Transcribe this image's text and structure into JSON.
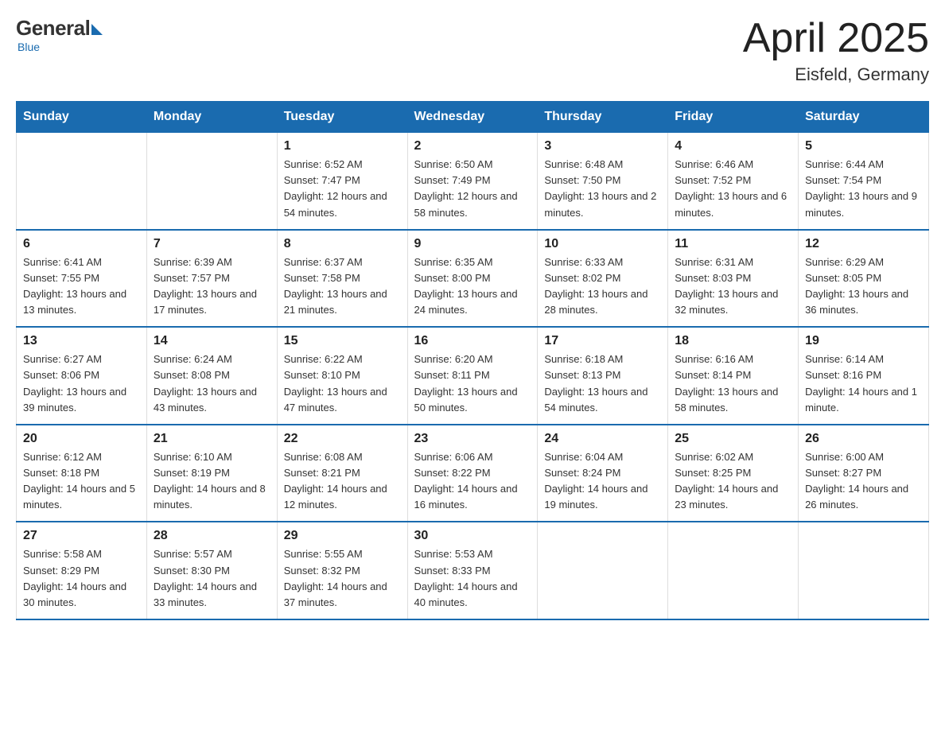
{
  "logo": {
    "general": "General",
    "blue": "Blue",
    "tagline": "Blue"
  },
  "header": {
    "month_year": "April 2025",
    "location": "Eisfeld, Germany"
  },
  "weekdays": [
    "Sunday",
    "Monday",
    "Tuesday",
    "Wednesday",
    "Thursday",
    "Friday",
    "Saturday"
  ],
  "weeks": [
    [
      {
        "day": "",
        "sunrise": "",
        "sunset": "",
        "daylight": ""
      },
      {
        "day": "",
        "sunrise": "",
        "sunset": "",
        "daylight": ""
      },
      {
        "day": "1",
        "sunrise": "Sunrise: 6:52 AM",
        "sunset": "Sunset: 7:47 PM",
        "daylight": "Daylight: 12 hours and 54 minutes."
      },
      {
        "day": "2",
        "sunrise": "Sunrise: 6:50 AM",
        "sunset": "Sunset: 7:49 PM",
        "daylight": "Daylight: 12 hours and 58 minutes."
      },
      {
        "day": "3",
        "sunrise": "Sunrise: 6:48 AM",
        "sunset": "Sunset: 7:50 PM",
        "daylight": "Daylight: 13 hours and 2 minutes."
      },
      {
        "day": "4",
        "sunrise": "Sunrise: 6:46 AM",
        "sunset": "Sunset: 7:52 PM",
        "daylight": "Daylight: 13 hours and 6 minutes."
      },
      {
        "day": "5",
        "sunrise": "Sunrise: 6:44 AM",
        "sunset": "Sunset: 7:54 PM",
        "daylight": "Daylight: 13 hours and 9 minutes."
      }
    ],
    [
      {
        "day": "6",
        "sunrise": "Sunrise: 6:41 AM",
        "sunset": "Sunset: 7:55 PM",
        "daylight": "Daylight: 13 hours and 13 minutes."
      },
      {
        "day": "7",
        "sunrise": "Sunrise: 6:39 AM",
        "sunset": "Sunset: 7:57 PM",
        "daylight": "Daylight: 13 hours and 17 minutes."
      },
      {
        "day": "8",
        "sunrise": "Sunrise: 6:37 AM",
        "sunset": "Sunset: 7:58 PM",
        "daylight": "Daylight: 13 hours and 21 minutes."
      },
      {
        "day": "9",
        "sunrise": "Sunrise: 6:35 AM",
        "sunset": "Sunset: 8:00 PM",
        "daylight": "Daylight: 13 hours and 24 minutes."
      },
      {
        "day": "10",
        "sunrise": "Sunrise: 6:33 AM",
        "sunset": "Sunset: 8:02 PM",
        "daylight": "Daylight: 13 hours and 28 minutes."
      },
      {
        "day": "11",
        "sunrise": "Sunrise: 6:31 AM",
        "sunset": "Sunset: 8:03 PM",
        "daylight": "Daylight: 13 hours and 32 minutes."
      },
      {
        "day": "12",
        "sunrise": "Sunrise: 6:29 AM",
        "sunset": "Sunset: 8:05 PM",
        "daylight": "Daylight: 13 hours and 36 minutes."
      }
    ],
    [
      {
        "day": "13",
        "sunrise": "Sunrise: 6:27 AM",
        "sunset": "Sunset: 8:06 PM",
        "daylight": "Daylight: 13 hours and 39 minutes."
      },
      {
        "day": "14",
        "sunrise": "Sunrise: 6:24 AM",
        "sunset": "Sunset: 8:08 PM",
        "daylight": "Daylight: 13 hours and 43 minutes."
      },
      {
        "day": "15",
        "sunrise": "Sunrise: 6:22 AM",
        "sunset": "Sunset: 8:10 PM",
        "daylight": "Daylight: 13 hours and 47 minutes."
      },
      {
        "day": "16",
        "sunrise": "Sunrise: 6:20 AM",
        "sunset": "Sunset: 8:11 PM",
        "daylight": "Daylight: 13 hours and 50 minutes."
      },
      {
        "day": "17",
        "sunrise": "Sunrise: 6:18 AM",
        "sunset": "Sunset: 8:13 PM",
        "daylight": "Daylight: 13 hours and 54 minutes."
      },
      {
        "day": "18",
        "sunrise": "Sunrise: 6:16 AM",
        "sunset": "Sunset: 8:14 PM",
        "daylight": "Daylight: 13 hours and 58 minutes."
      },
      {
        "day": "19",
        "sunrise": "Sunrise: 6:14 AM",
        "sunset": "Sunset: 8:16 PM",
        "daylight": "Daylight: 14 hours and 1 minute."
      }
    ],
    [
      {
        "day": "20",
        "sunrise": "Sunrise: 6:12 AM",
        "sunset": "Sunset: 8:18 PM",
        "daylight": "Daylight: 14 hours and 5 minutes."
      },
      {
        "day": "21",
        "sunrise": "Sunrise: 6:10 AM",
        "sunset": "Sunset: 8:19 PM",
        "daylight": "Daylight: 14 hours and 8 minutes."
      },
      {
        "day": "22",
        "sunrise": "Sunrise: 6:08 AM",
        "sunset": "Sunset: 8:21 PM",
        "daylight": "Daylight: 14 hours and 12 minutes."
      },
      {
        "day": "23",
        "sunrise": "Sunrise: 6:06 AM",
        "sunset": "Sunset: 8:22 PM",
        "daylight": "Daylight: 14 hours and 16 minutes."
      },
      {
        "day": "24",
        "sunrise": "Sunrise: 6:04 AM",
        "sunset": "Sunset: 8:24 PM",
        "daylight": "Daylight: 14 hours and 19 minutes."
      },
      {
        "day": "25",
        "sunrise": "Sunrise: 6:02 AM",
        "sunset": "Sunset: 8:25 PM",
        "daylight": "Daylight: 14 hours and 23 minutes."
      },
      {
        "day": "26",
        "sunrise": "Sunrise: 6:00 AM",
        "sunset": "Sunset: 8:27 PM",
        "daylight": "Daylight: 14 hours and 26 minutes."
      }
    ],
    [
      {
        "day": "27",
        "sunrise": "Sunrise: 5:58 AM",
        "sunset": "Sunset: 8:29 PM",
        "daylight": "Daylight: 14 hours and 30 minutes."
      },
      {
        "day": "28",
        "sunrise": "Sunrise: 5:57 AM",
        "sunset": "Sunset: 8:30 PM",
        "daylight": "Daylight: 14 hours and 33 minutes."
      },
      {
        "day": "29",
        "sunrise": "Sunrise: 5:55 AM",
        "sunset": "Sunset: 8:32 PM",
        "daylight": "Daylight: 14 hours and 37 minutes."
      },
      {
        "day": "30",
        "sunrise": "Sunrise: 5:53 AM",
        "sunset": "Sunset: 8:33 PM",
        "daylight": "Daylight: 14 hours and 40 minutes."
      },
      {
        "day": "",
        "sunrise": "",
        "sunset": "",
        "daylight": ""
      },
      {
        "day": "",
        "sunrise": "",
        "sunset": "",
        "daylight": ""
      },
      {
        "day": "",
        "sunrise": "",
        "sunset": "",
        "daylight": ""
      }
    ]
  ]
}
